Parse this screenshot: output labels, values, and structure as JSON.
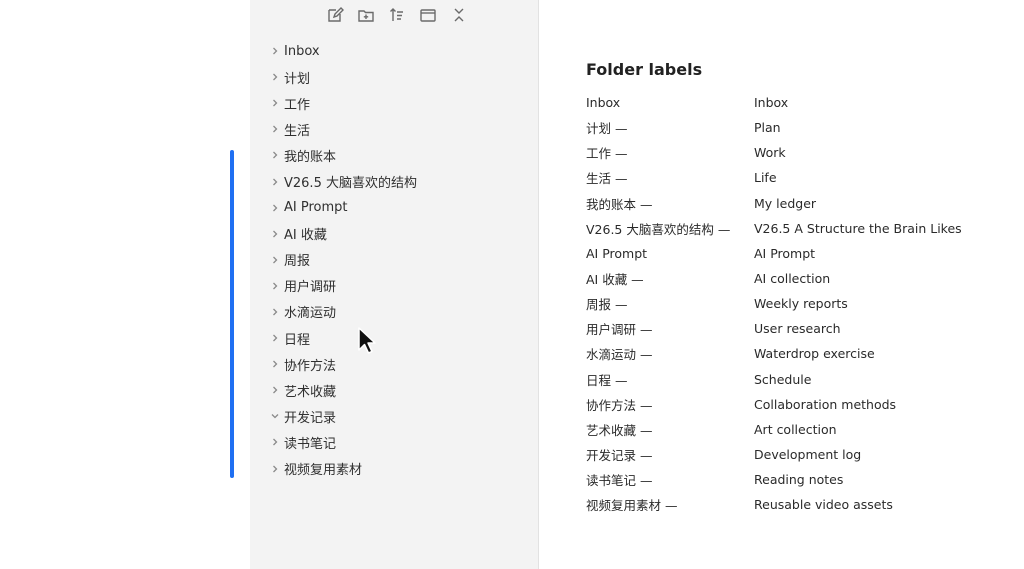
{
  "colors": {
    "accent": "#1f6ff2",
    "sidebar_bg": "#f3f3f3"
  },
  "toolbar": {
    "buttons": [
      {
        "icon": "edit-note-icon"
      },
      {
        "icon": "new-folder-icon"
      },
      {
        "icon": "sort-icon"
      },
      {
        "icon": "window-icon"
      },
      {
        "icon": "collapse-all-icon"
      }
    ]
  },
  "sidebar": {
    "items": [
      {
        "label": "Inbox",
        "expanded": false
      },
      {
        "label": "计划",
        "expanded": false
      },
      {
        "label": "工作",
        "expanded": false
      },
      {
        "label": "生活",
        "expanded": false
      },
      {
        "label": "我的账本",
        "expanded": false
      },
      {
        "label": "V26.5 大脑喜欢的结构",
        "expanded": false
      },
      {
        "label": "AI Prompt",
        "expanded": false
      },
      {
        "label": "AI 收藏",
        "expanded": false
      },
      {
        "label": "周报",
        "expanded": false
      },
      {
        "label": "用户调研",
        "expanded": false
      },
      {
        "label": "水滴运动",
        "expanded": false
      },
      {
        "label": "日程",
        "expanded": false
      },
      {
        "label": "协作方法",
        "expanded": false
      },
      {
        "label": "艺术收藏",
        "expanded": false
      },
      {
        "label": "开发记录",
        "expanded": true
      },
      {
        "label": "读书笔记",
        "expanded": false
      },
      {
        "label": "视频复用素材",
        "expanded": false
      }
    ]
  },
  "content": {
    "title": "Folder labels",
    "rows": [
      {
        "src": "Inbox",
        "en": "Inbox"
      },
      {
        "src": "计划 —",
        "en": "Plan"
      },
      {
        "src": "工作 —",
        "en": "Work"
      },
      {
        "src": "生活 —",
        "en": "Life"
      },
      {
        "src": "我的账本 —",
        "en": "My ledger"
      },
      {
        "src": "V26.5 大脑喜欢的结构 —",
        "en": "V26.5 A Structure the Brain Likes"
      },
      {
        "src": "AI Prompt",
        "en": "AI Prompt"
      },
      {
        "src": "AI 收藏 —",
        "en": "AI collection"
      },
      {
        "src": "周报 —",
        "en": "Weekly reports"
      },
      {
        "src": "用户调研 —",
        "en": "User research"
      },
      {
        "src": "水滴运动 —",
        "en": "Waterdrop exercise"
      },
      {
        "src": "日程 —",
        "en": "Schedule"
      },
      {
        "src": "协作方法 —",
        "en": "Collaboration methods"
      },
      {
        "src": "艺术收藏 —",
        "en": "Art collection"
      },
      {
        "src": "开发记录 —",
        "en": "Development log"
      },
      {
        "src": "读书笔记 —",
        "en": "Reading notes"
      },
      {
        "src": "视频复用素材 —",
        "en": "Reusable video assets"
      }
    ]
  }
}
